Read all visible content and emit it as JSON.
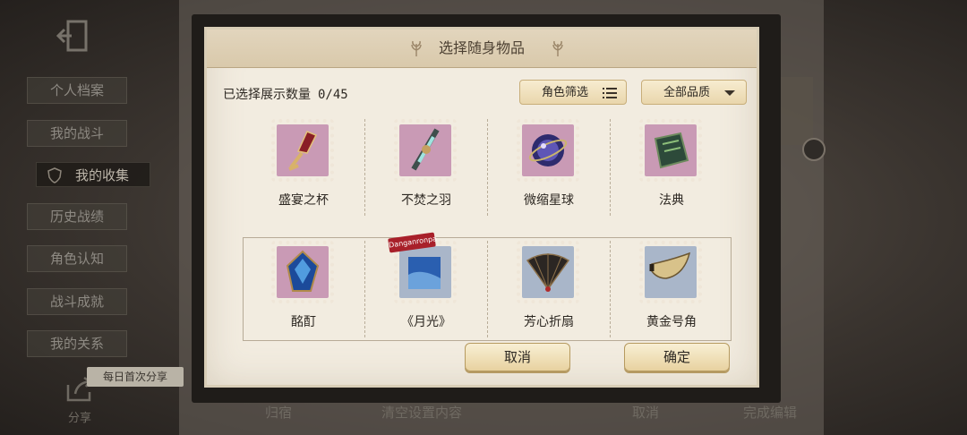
{
  "background": {
    "side_menu": [
      {
        "label": "个人档案",
        "active": false
      },
      {
        "label": "我的战斗",
        "active": false
      },
      {
        "label": "我的收集",
        "active": true
      },
      {
        "label": "历史战绩",
        "active": false
      },
      {
        "label": "角色认知",
        "active": false
      },
      {
        "label": "战斗成就",
        "active": false
      },
      {
        "label": "我的关系",
        "active": false
      }
    ],
    "share_tag": "每日首次分享",
    "share_label": "分享",
    "bottom_bar": [
      "归宿",
      "清空设置内容",
      "取消",
      "完成编辑"
    ]
  },
  "modal": {
    "title": "选择随身物品",
    "count_label": "已选择展示数量",
    "count_value": "0/45",
    "filter_role": "角色筛选",
    "filter_quality": "全部品质",
    "items": [
      {
        "name": "盛宴之杯",
        "icon": "feast-cup-icon",
        "stamp_color": "#c99ab5"
      },
      {
        "name": "不焚之羽",
        "icon": "unburning-feather-icon",
        "stamp_color": "#c99ab5"
      },
      {
        "name": "微缩星球",
        "icon": "miniature-planet-icon",
        "stamp_color": "#c99ab5"
      },
      {
        "name": "法典",
        "icon": "codex-icon",
        "stamp_color": "#c99ab5"
      },
      {
        "name": "酩酊",
        "icon": "blue-crystal-icon",
        "stamp_color": "#c99ab5"
      },
      {
        "name": "《月光》",
        "icon": "moonlight-record-icon",
        "stamp_color": "#a9b6c9",
        "badge": "Danganronpa"
      },
      {
        "name": "芳心折扇",
        "icon": "folding-fan-icon",
        "stamp_color": "#a9b6c9"
      },
      {
        "name": "黄金号角",
        "icon": "golden-horn-icon",
        "stamp_color": "#a9b6c9"
      }
    ],
    "cancel_label": "取消",
    "confirm_label": "确定"
  }
}
